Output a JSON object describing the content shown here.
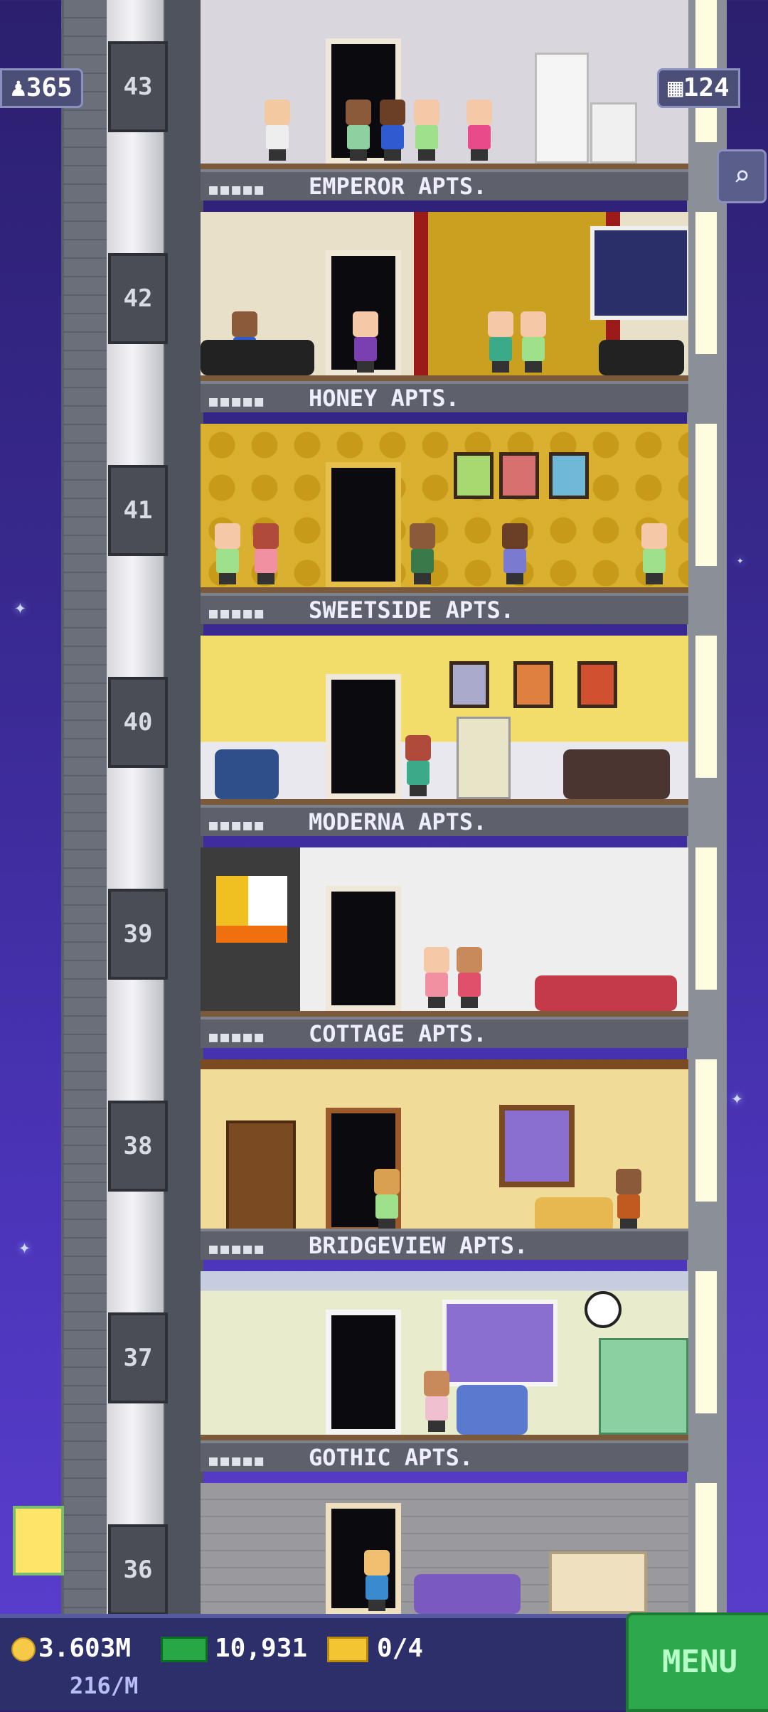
{
  "hud": {
    "population": "365",
    "floors": "124"
  },
  "floors": [
    {
      "num": "43",
      "name": "EMPEROR APTS."
    },
    {
      "num": "42",
      "name": "HONEY APTS."
    },
    {
      "num": "41",
      "name": "SWEETSIDE APTS."
    },
    {
      "num": "40",
      "name": "MODERNA APTS."
    },
    {
      "num": "39",
      "name": "COTTAGE APTS."
    },
    {
      "num": "38",
      "name": "BRIDGEVIEW APTS."
    },
    {
      "num": "37",
      "name": "GOTHIC APTS."
    },
    {
      "num": "36",
      "name": ""
    }
  ],
  "bottom": {
    "coins": "3.603M",
    "rate": "216/M",
    "bux": "10,931",
    "tickets": "0/4",
    "menu": "MENU"
  },
  "icons": {
    "population": "person-icon",
    "floors": "building-icon",
    "search": "magnifier-icon",
    "coin": "coin-icon",
    "bux": "tower-bux-icon",
    "ticket": "vip-ticket-icon"
  },
  "colors": {
    "sky": "#3a2a94",
    "menu": "#2ea84d",
    "bottom_bar": "#2d2f6a"
  }
}
